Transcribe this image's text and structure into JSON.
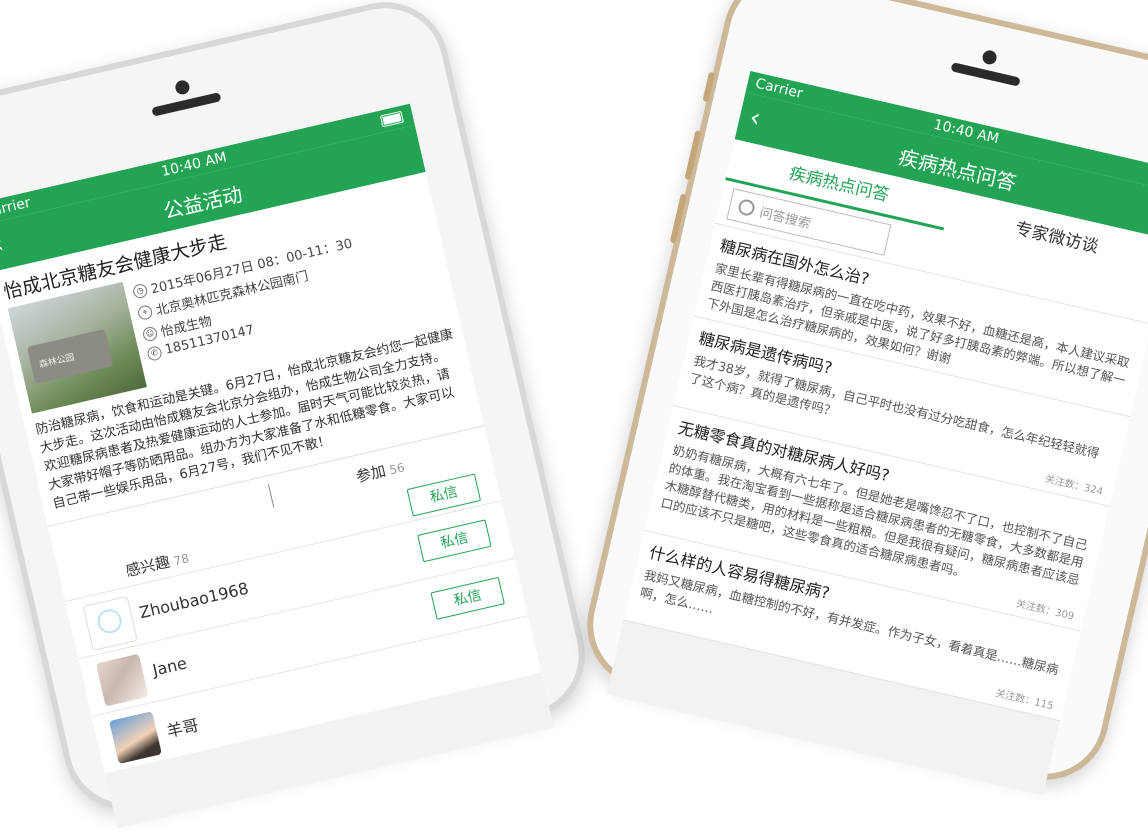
{
  "colors": {
    "brand": "#23a455"
  },
  "left": {
    "status": {
      "carrier": "Carrier",
      "time": "10:40 AM"
    },
    "nav": {
      "back_icon": "chevron-left-icon",
      "title": "公益活动"
    },
    "event": {
      "title": "怡成北京糖友会健康大步走",
      "photo_sign": "森林公园",
      "time": "2015年06月27日 08：00-11：30",
      "place": "北京奥林匹克森林公园南门",
      "organizer": "怡成生物",
      "phone": "18511370147",
      "description": "防治糖尿病，饮食和运动是关键。6月27日，怡成北京糖友会约您一起健康大步走。这次活动由怡成糖友会北京分会组办，怡成生物公司全力支持。欢迎糖尿病患者及热爱健康运动的人士参加。届时天气可能比较炎热，请大家带好帽子等防晒用品。组办方为大家准备了水和低糖零食。大家可以自己带一些娱乐用品，6月27号，我们不见不散！"
    },
    "tabs": {
      "join_label": "参加",
      "join_count": "56",
      "interest_label": "感兴趣",
      "interest_count": "78"
    },
    "message_label": "私信",
    "users": [
      {
        "name": "Zhoubao1968"
      },
      {
        "name": "Jane"
      },
      {
        "name": "羊哥"
      }
    ]
  },
  "right": {
    "status": {
      "carrier": "Carrier",
      "time": "10:40 AM"
    },
    "nav": {
      "back_icon": "chevron-left-icon",
      "title": "疾病热点问答"
    },
    "tabs": [
      {
        "label": "疾病热点问答",
        "active": true
      },
      {
        "label": "专家微访谈",
        "active": false
      }
    ],
    "search_placeholder": "问答搜索",
    "questions": [
      {
        "q": "糖尿病在国外怎么治?",
        "a": "家里长辈有得糖尿病的一直在吃中药，效果不好，血糖还是高，本人建议采取西医打胰岛素治疗，但亲戚是中医，说了好多打胰岛素的弊端。所以想了解一下外国是怎么治疗糖尿病的，效果如何？谢谢",
        "f": ""
      },
      {
        "q": "糖尿病是遗传病吗?",
        "a": "我才38岁，就得了糖尿病，自己平时也没有过分吃甜食，怎么年纪轻轻就得了这个病？真的是遗传吗？",
        "f": "关注数：324"
      },
      {
        "q": "无糖零食真的对糖尿病人好吗?",
        "a": "奶奶有糖尿病，大概有六七年了。但是她老是嘴馋忍不了口，也控制不了自己的体重。我在淘宝看到一些据称是适合糖尿病患者的无糖零食，大多数都是用木糖醇替代糖类，用的材料是一些粗粮。但是我很有疑问，糖尿病患者应该忌口的应该不只是糖吧，这些零食真的适合糖尿病患者吗。",
        "f": "关注数：309"
      },
      {
        "q": "什么样的人容易得糖尿病?",
        "a": "我妈又糖尿病，血糖控制的不好，有并发症。作为子女，看着真是……糖尿病啊，怎么……",
        "f": "关注数：115"
      }
    ]
  }
}
